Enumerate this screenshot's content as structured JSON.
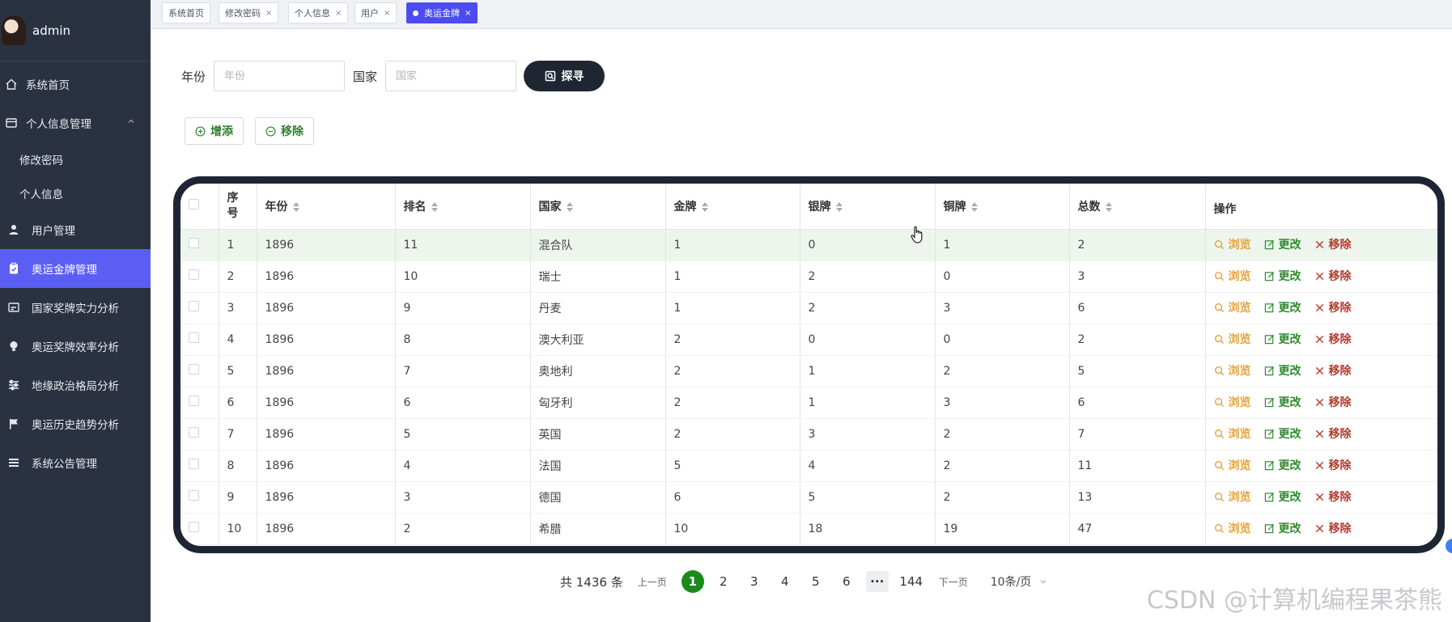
{
  "sidebar": {
    "username": "admin",
    "items": [
      {
        "label": "系统首页",
        "icon": "home-icon"
      },
      {
        "label": "个人信息管理",
        "icon": "card-icon"
      },
      {
        "label": "修改密码"
      },
      {
        "label": "个人信息"
      },
      {
        "label": "用户管理",
        "icon": "user-icon"
      },
      {
        "label": "奥运金牌管理",
        "icon": "clipboard-icon"
      },
      {
        "label": "国家奖牌实力分析",
        "icon": "chart-icon"
      },
      {
        "label": "奥运奖牌效率分析",
        "icon": "bulb-icon"
      },
      {
        "label": "地缘政治格局分析",
        "icon": "sliders-icon"
      },
      {
        "label": "奥运历史趋势分析",
        "icon": "flag-icon"
      },
      {
        "label": "系统公告管理",
        "icon": "menu-icon"
      }
    ]
  },
  "tabs": [
    {
      "label": "系统首页"
    },
    {
      "label": "修改密码",
      "close": "×"
    },
    {
      "label": "个人信息",
      "close": "×"
    },
    {
      "label": "用户",
      "close": "×"
    },
    {
      "label": "奥运金牌",
      "close": "×",
      "active": true
    }
  ],
  "search": {
    "year_label": "年份",
    "year_placeholder": "年份",
    "country_label": "国家",
    "country_placeholder": "国家",
    "search_button": "探寻"
  },
  "actions": {
    "add": "增添",
    "remove": "移除"
  },
  "table": {
    "headers": [
      "序号",
      "年份",
      "排名",
      "国家",
      "金牌",
      "银牌",
      "铜牌",
      "总数",
      "操作"
    ],
    "row_actions": {
      "view": "浏览",
      "edit": "更改",
      "delete": "移除"
    },
    "rows": [
      [
        "1",
        "1896",
        "11",
        "混合队",
        "1",
        "0",
        "1",
        "2"
      ],
      [
        "2",
        "1896",
        "10",
        "瑞士",
        "1",
        "2",
        "0",
        "3"
      ],
      [
        "3",
        "1896",
        "9",
        "丹麦",
        "1",
        "2",
        "3",
        "6"
      ],
      [
        "4",
        "1896",
        "8",
        "澳大利亚",
        "2",
        "0",
        "0",
        "2"
      ],
      [
        "5",
        "1896",
        "7",
        "奥地利",
        "2",
        "1",
        "2",
        "5"
      ],
      [
        "6",
        "1896",
        "6",
        "匈牙利",
        "2",
        "1",
        "3",
        "6"
      ],
      [
        "7",
        "1896",
        "5",
        "英国",
        "2",
        "3",
        "2",
        "7"
      ],
      [
        "8",
        "1896",
        "4",
        "法国",
        "5",
        "4",
        "2",
        "11"
      ],
      [
        "9",
        "1896",
        "3",
        "德国",
        "6",
        "5",
        "2",
        "13"
      ],
      [
        "10",
        "1896",
        "2",
        "希腊",
        "10",
        "18",
        "19",
        "47"
      ]
    ]
  },
  "pagination": {
    "total": "共 1436 条",
    "prev": "上一页",
    "pages": [
      "1",
      "2",
      "3",
      "4",
      "5",
      "6"
    ],
    "more": "···",
    "last": "144",
    "next": "下一页",
    "page_size": "10条/页",
    "current": "1"
  },
  "watermark": "CSDN @计算机编程果茶熊",
  "colors": {
    "sidebar_bg": "#2a3242",
    "active_menu": "#5b5ef3",
    "active_tab": "#4a4cf0",
    "view": "#e6a23c",
    "edit": "#2e8b2e",
    "delete": "#b23b2e",
    "current_page": "#1a8a1a"
  }
}
